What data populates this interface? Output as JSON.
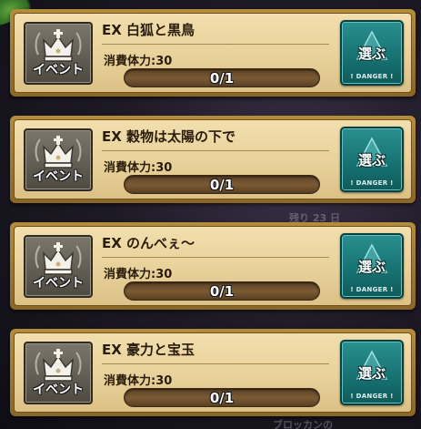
{
  "background": {
    "text_top": "",
    "text_mid": "残り 23 日",
    "text_bottom": "ブロッカンの"
  },
  "quests": [
    {
      "icon": "crown-icon",
      "badge": "イベント",
      "title": "EX 白狐と黒鳥",
      "stamina": "消費体力:30",
      "progress_text": "0/1",
      "progress": 0,
      "button": "選ぶ",
      "danger": "! DANGER !"
    },
    {
      "icon": "crown-icon",
      "badge": "イベント",
      "title": "EX 穀物は太陽の下で",
      "stamina": "消費体力:30",
      "progress_text": "0/1",
      "progress": 0,
      "button": "選ぶ",
      "danger": "! DANGER !"
    },
    {
      "icon": "crown-icon",
      "badge": "イベント",
      "title": "EX のんべぇ～",
      "stamina": "消費体力:30",
      "progress_text": "0/1",
      "progress": 0,
      "button": "選ぶ",
      "danger": "! DANGER !"
    },
    {
      "icon": "crown-icon",
      "badge": "イベント",
      "title": "EX 豪力と宝玉",
      "stamina": "消費体力:30",
      "progress_text": "0/1",
      "progress": 0,
      "button": "選ぶ",
      "danger": "! DANGER !"
    }
  ],
  "colors": {
    "card_border": "#b38d3c",
    "card_fill": "#f2dfae",
    "button_teal": "#187373",
    "progress_track": "#5a4023"
  }
}
